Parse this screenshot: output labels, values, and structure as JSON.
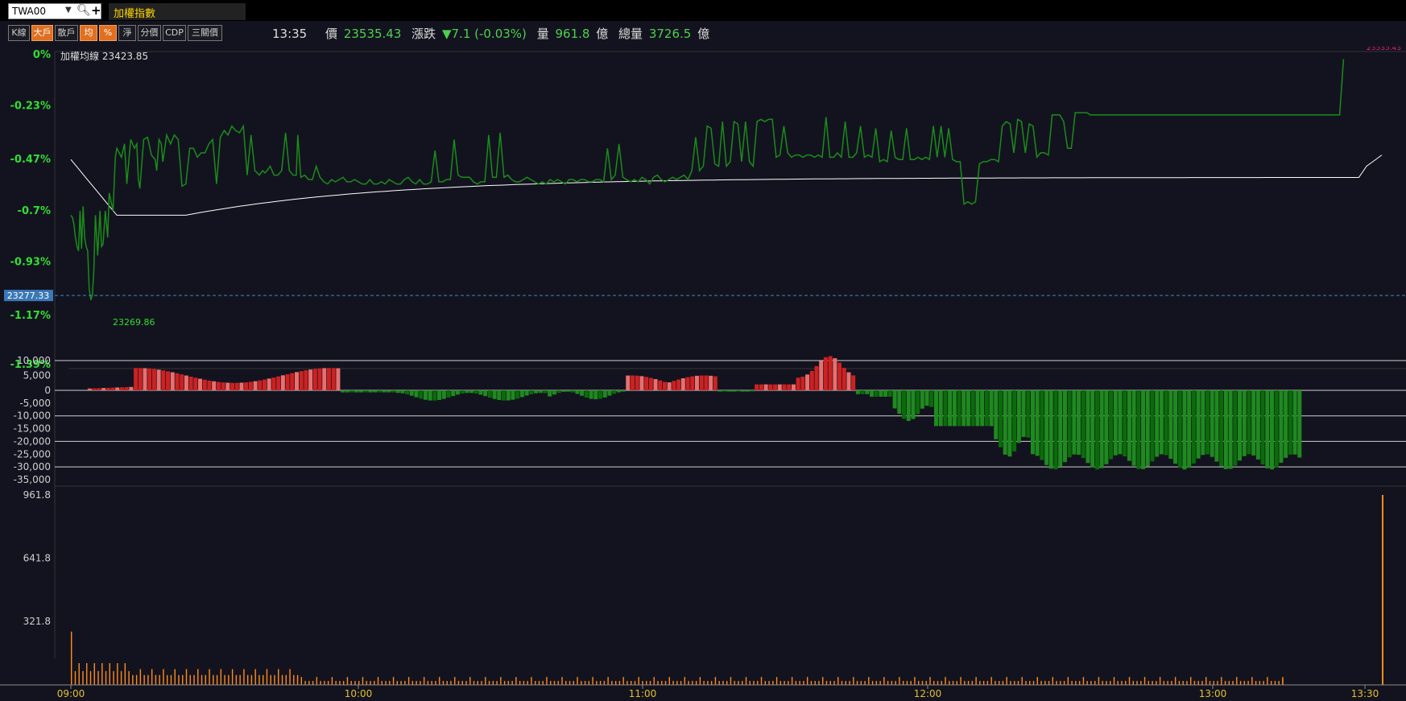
{
  "symbol": {
    "code": "TWA00",
    "name": "加權指數"
  },
  "toolbar": {
    "buttons": [
      {
        "label": "K線",
        "active": false
      },
      {
        "label": "大戶",
        "active": true
      },
      {
        "label": "散戶",
        "active": false
      },
      {
        "label": "均",
        "active": true
      },
      {
        "label": "%",
        "active": true
      },
      {
        "label": "淨",
        "active": false
      },
      {
        "label": "分價",
        "active": false
      },
      {
        "label": "CDP",
        "active": false
      },
      {
        "label": "三關價",
        "active": false
      }
    ]
  },
  "quote": {
    "time": "13:35",
    "price_label": "價",
    "price": "23535.43",
    "change_label": "漲跌",
    "change": "▼7.1 (-0.03%)",
    "volume_label": "量",
    "volume": "961.8",
    "volume_unit": "億",
    "total_label": "總量",
    "total": "3726.5",
    "total_unit": "億"
  },
  "colors": {
    "background": "#13131f",
    "up": "#cc2222",
    "up_light": "#e87070",
    "down": "#1f8a1f",
    "down_dark": "#0b6b0b",
    "price_line": "#1a8c1a",
    "avg_line": "#ffffff",
    "volume": "#ff8c1a",
    "ref_line": "#3a88c8",
    "axis_text": "#33dd33"
  },
  "chart_data": [
    {
      "type": "line",
      "panel": "price",
      "avg_label": "加權均線 23423.85",
      "y_ticks": [
        "0%",
        "-0.23%",
        "-0.47%",
        "-0.7%",
        "-0.93%",
        "-1.17%",
        "-1.39%"
      ],
      "y_tick_values": [
        0,
        -0.23,
        -0.47,
        -0.7,
        -0.93,
        -1.17,
        -1.39
      ],
      "ylim": [
        -1.39,
        0
      ],
      "ref_line_label": "23277.33",
      "ref_line_value": -1.08,
      "low_label": "23269.86",
      "high_label": "23535.43",
      "x_ticks": [
        "09:00",
        "10:00",
        "11:00",
        "12:00",
        "13:00",
        "13:30"
      ],
      "series": [
        {
          "key": "price",
          "t": [
            0,
            2,
            4,
            6,
            8,
            10,
            12,
            14,
            16,
            18,
            20,
            22,
            24,
            26,
            28,
            30,
            32,
            35,
            38,
            40,
            42,
            45,
            48,
            50,
            55,
            58,
            60,
            63,
            66,
            70,
            73,
            78,
            83,
            86,
            88,
            90,
            95,
            100,
            102,
            105,
            110,
            112,
            115,
            118,
            120,
            125,
            130,
            135,
            140,
            145,
            150,
            155,
            160,
            165,
            170,
            175,
            180,
            185,
            190,
            195,
            200,
            205,
            210,
            215,
            220,
            225,
            230,
            235,
            240,
            243,
            246,
            250,
            253,
            256,
            260,
            265,
            270,
            275,
            280,
            285,
            290,
            294,
            296,
            300,
            305,
            310,
            315,
            320,
            325,
            330,
            335,
            340,
            345,
            350,
            355,
            360,
            365,
            370,
            375,
            380,
            385,
            390,
            395,
            400,
            405,
            410,
            415,
            420,
            425,
            430,
            435,
            440,
            445,
            450,
            455,
            460,
            465,
            470,
            475,
            480,
            485,
            490,
            495,
            500,
            505,
            510,
            515,
            520,
            525,
            530,
            535,
            540,
            545,
            550,
            555,
            560,
            565,
            570,
            575,
            580,
            585,
            590,
            595,
            600,
            605,
            610,
            615,
            620,
            625,
            630,
            635,
            640,
            645,
            650,
            655,
            660,
            665,
            670,
            675,
            680,
            685,
            690,
            695,
            700,
            705,
            710,
            715,
            720,
            725,
            730,
            735,
            740,
            745,
            750,
            755,
            760,
            765,
            770,
            775,
            780,
            785,
            790,
            795,
            800,
            805,
            810,
            815,
            820,
            825,
            830,
            835,
            840,
            845,
            850,
            855,
            860,
            865,
            870,
            875,
            880,
            885,
            890,
            895,
            900,
            905,
            910,
            915,
            920,
            925,
            930,
            935,
            940,
            945,
            950,
            955,
            960,
            965,
            970,
            975,
            980,
            985,
            990,
            995,
            1000,
            1005,
            1010,
            1015,
            1020,
            1025,
            1030,
            1035,
            1040,
            1045,
            1050,
            1055,
            1060,
            1065,
            1070,
            1075,
            1080,
            1085,
            1090,
            1095,
            1100,
            1105,
            1110,
            1115,
            1120,
            1125,
            1130,
            1135,
            1140,
            1145,
            1150,
            1155,
            1160,
            1165,
            1170,
            1175,
            1180,
            1185,
            1190,
            1195,
            1200,
            1205,
            1210,
            1215,
            1220,
            1225,
            1230,
            1235,
            1240,
            1245,
            1250,
            1255,
            1260,
            1265,
            1270,
            1275,
            1280,
            1285,
            1290,
            1295,
            1300,
            1305,
            1310,
            1315,
            1320,
            1325,
            1330,
            1335,
            1340,
            1345,
            1350,
            1355,
            1360,
            1365,
            1370,
            1375,
            1380,
            1385,
            1390,
            1395,
            1400,
            1405,
            1410,
            1415,
            1420,
            1425,
            1430,
            1435,
            1440,
            1445,
            1450,
            1455,
            1460,
            1465,
            1470,
            1475,
            1480,
            1485,
            1490,
            1495,
            1500,
            1505,
            1510,
            1515,
            1520,
            1525,
            1530,
            1535,
            1540,
            1545,
            1550,
            1555,
            1560,
            1565,
            1570,
            1575,
            1580,
            1585,
            1590,
            1595,
            1600,
            1605,
            1610,
            1615,
            1620,
            1625,
            1630,
            1635,
            1640,
            1645,
            1650,
            1655,
            1660,
            1665,
            1670,
            1675,
            1680,
            1685,
            1690,
            1695,
            1700,
            1705,
            1710
          ],
          "values": [
            -0.72,
            -0.73,
            -0.76,
            -0.82,
            -0.86,
            -0.88,
            -0.7,
            -0.87,
            -0.68,
            -0.82,
            -0.86,
            -0.88,
            -1.05,
            -1.1,
            -1.08,
            -0.96,
            -0.72,
            -0.9,
            -0.7,
            -0.86,
            -0.85,
            -0.7,
            -0.82,
            -0.62,
            -0.7,
            -0.46,
            -0.42,
            -0.44,
            -0.46,
            -0.4,
            -0.58,
            -0.38,
            -0.42,
            -0.4,
            -0.56,
            -0.6,
            -0.38,
            -0.37,
            -0.4,
            -0.45,
            -0.47,
            -0.52,
            -0.38,
            -0.4,
            -0.48,
            -0.36,
            -0.4,
            -0.36,
            -0.38,
            -0.59,
            -0.58,
            -0.42,
            -0.42,
            -0.46,
            -0.44,
            -0.44,
            -0.4,
            -0.38,
            -0.58,
            -0.37,
            -0.34,
            -0.36,
            -0.32,
            -0.34,
            -0.35,
            -0.32,
            -0.54,
            -0.36,
            -0.52,
            -0.53,
            -0.54,
            -0.52,
            -0.53,
            -0.52,
            -0.5,
            -0.54,
            -0.54,
            -0.52,
            -0.35,
            -0.52,
            -0.54,
            -0.54,
            -0.36,
            -0.55,
            -0.54,
            -0.56,
            -0.56,
            -0.5,
            -0.55,
            -0.57,
            -0.58,
            -0.56,
            -0.57,
            -0.56,
            -0.55,
            -0.57,
            -0.57,
            -0.56,
            -0.57,
            -0.58,
            -0.58,
            -0.56,
            -0.58,
            -0.58,
            -0.57,
            -0.58,
            -0.56,
            -0.57,
            -0.58,
            -0.58,
            -0.56,
            -0.55,
            -0.57,
            -0.58,
            -0.56,
            -0.58,
            -0.58,
            -0.57,
            -0.43,
            -0.57,
            -0.57,
            -0.56,
            -0.56,
            -0.38,
            -0.54,
            -0.55,
            -0.55,
            -0.55,
            -0.57,
            -0.58,
            -0.57,
            -0.57,
            -0.36,
            -0.55,
            -0.55,
            -0.35,
            -0.55,
            -0.54,
            -0.56,
            -0.57,
            -0.57,
            -0.56,
            -0.55,
            -0.56,
            -0.57,
            -0.58,
            -0.57,
            -0.58,
            -0.56,
            -0.57,
            -0.56,
            -0.57,
            -0.58,
            -0.56,
            -0.56,
            -0.57,
            -0.56,
            -0.56,
            -0.57,
            -0.57,
            -0.56,
            -0.56,
            -0.57,
            -0.42,
            -0.56,
            -0.54,
            -0.4,
            -0.55,
            -0.56,
            -0.57,
            -0.56,
            -0.57,
            -0.55,
            -0.56,
            -0.58,
            -0.55,
            -0.54,
            -0.56,
            -0.57,
            -0.56,
            -0.55,
            -0.56,
            -0.55,
            -0.54,
            -0.56,
            -0.52,
            -0.37,
            -0.52,
            -0.5,
            -0.32,
            -0.33,
            -0.49,
            -0.5,
            -0.3,
            -0.5,
            -0.48,
            -0.3,
            -0.31,
            -0.48,
            -0.3,
            -0.48,
            -0.5,
            -0.3,
            -0.29,
            -0.3,
            -0.29,
            -0.29,
            -0.46,
            -0.45,
            -0.32,
            -0.44,
            -0.46,
            -0.45,
            -0.45,
            -0.46,
            -0.45,
            -0.45,
            -0.46,
            -0.45,
            -0.46,
            -0.28,
            -0.46,
            -0.46,
            -0.44,
            -0.46,
            -0.3,
            -0.46,
            -0.46,
            -0.44,
            -0.32,
            -0.46,
            -0.45,
            -0.46,
            -0.33,
            -0.48,
            -0.47,
            -0.48,
            -0.34,
            -0.46,
            -0.47,
            -0.47,
            -0.33,
            -0.47,
            -0.47,
            -0.46,
            -0.47,
            -0.46,
            -0.47,
            -0.32,
            -0.46,
            -0.32,
            -0.46,
            -0.33,
            -0.47,
            -0.48,
            -0.48,
            -0.67,
            -0.66,
            -0.67,
            -0.66,
            -0.49,
            -0.48,
            -0.48,
            -0.47,
            -0.47,
            -0.48,
            -0.32,
            -0.3,
            -0.31,
            -0.44,
            -0.29,
            -0.3,
            -0.44,
            -0.31,
            -0.32,
            -0.46,
            -0.44,
            -0.44,
            -0.45,
            -0.27,
            -0.27,
            -0.27,
            -0.3,
            -0.42,
            -0.42,
            -0.26,
            -0.26,
            -0.26,
            -0.26,
            -0.27,
            -0.27,
            -0.27,
            -0.27,
            -0.27,
            -0.27,
            -0.27,
            -0.27,
            -0.27,
            -0.27,
            -0.27,
            -0.27,
            -0.27,
            -0.27,
            -0.27,
            -0.27,
            -0.27,
            -0.27,
            -0.27,
            -0.27,
            -0.27,
            -0.27,
            -0.27,
            -0.27,
            -0.27,
            -0.27,
            -0.27,
            -0.27,
            -0.27,
            -0.27,
            -0.27,
            -0.27,
            -0.27,
            -0.27,
            -0.27,
            -0.27,
            -0.27,
            -0.27,
            -0.27,
            -0.27,
            -0.27,
            -0.27,
            -0.27,
            -0.27,
            -0.27,
            -0.27,
            -0.27,
            -0.27,
            -0.27,
            -0.27,
            -0.27,
            -0.27,
            -0.27,
            -0.27,
            -0.27,
            -0.27,
            -0.27,
            -0.27,
            -0.27,
            -0.27,
            -0.27,
            -0.27,
            -0.27,
            -0.27,
            -0.27,
            -0.27,
            -0.02
          ]
        }
      ]
    },
    {
      "type": "bar",
      "panel": "large_holders",
      "y_ticks": [
        "10,000",
        "5,000",
        "0",
        "-5,000",
        "-10,000",
        "-15,000",
        "-20,000",
        "-25,000",
        "-30,000",
        "-35,000"
      ],
      "y_tick_values": [
        10000,
        5000,
        0,
        -5000,
        -10000,
        -15000,
        -20000,
        -25000,
        -30000,
        -35000
      ],
      "ylim": [
        -36000,
        14000
      ]
    },
    {
      "type": "bar",
      "panel": "volume",
      "y_ticks": [
        "961.8",
        "641.8",
        "321.8"
      ],
      "y_tick_values": [
        961.8,
        641.8,
        321.8
      ],
      "ylim": [
        0,
        1000
      ],
      "last_value": 961.8
    }
  ]
}
